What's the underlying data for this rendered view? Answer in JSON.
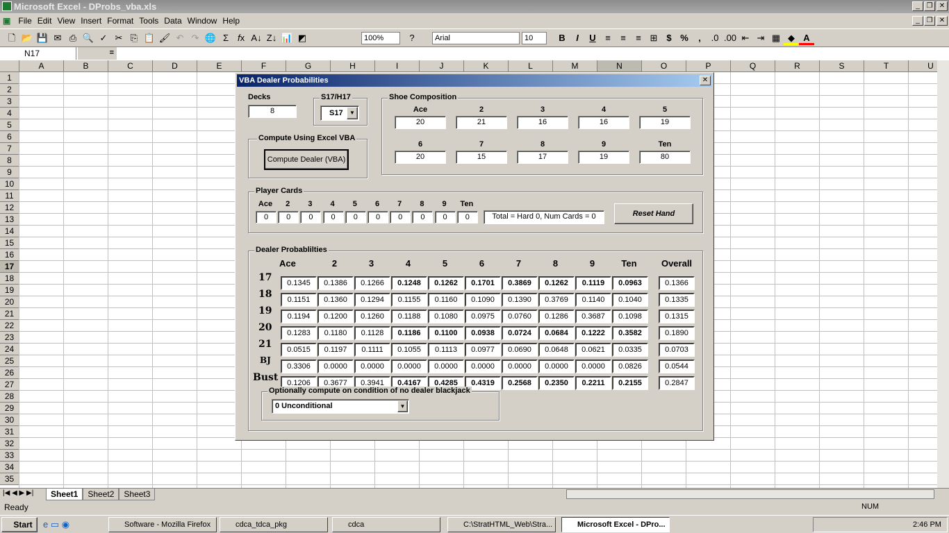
{
  "window": {
    "title": "Microsoft Excel - DProbs_vba.xls"
  },
  "menu": [
    "File",
    "Edit",
    "View",
    "Insert",
    "Format",
    "Tools",
    "Data",
    "Window",
    "Help"
  ],
  "toolbar": {
    "zoom": "100%",
    "font": "Arial",
    "font_size": "10",
    "bold": "B",
    "italic": "I",
    "underline": "U",
    "currency": "$",
    "percent": "%",
    "comma": ","
  },
  "formula_bar": {
    "name_box": "N17",
    "equals": "=",
    "value": ""
  },
  "columns": [
    "A",
    "B",
    "C",
    "D",
    "E",
    "F",
    "G",
    "H",
    "I",
    "J",
    "K",
    "L",
    "M",
    "N",
    "O",
    "P",
    "Q",
    "R",
    "S",
    "T",
    "U"
  ],
  "rows": [
    "1",
    "2",
    "3",
    "4",
    "5",
    "6",
    "7",
    "8",
    "9",
    "10",
    "11",
    "12",
    "13",
    "14",
    "15",
    "16",
    "17",
    "18",
    "19",
    "20",
    "21",
    "22",
    "23",
    "24",
    "25",
    "26",
    "27",
    "28",
    "29",
    "30",
    "31",
    "32",
    "33",
    "34",
    "35"
  ],
  "sheets": [
    "Sheet1",
    "Sheet2",
    "Sheet3"
  ],
  "status": {
    "text": "Ready",
    "num": "NUM"
  },
  "dialog": {
    "title": "VBA Dealer Probabilities",
    "decks": {
      "label": "Decks",
      "value": "8"
    },
    "soft17": {
      "label": "S17/H17",
      "value": "S17"
    },
    "compute": {
      "label": "Compute Using Excel VBA",
      "button": "Compute Dealer (VBA)"
    },
    "shoe": {
      "label": "Shoe Composition",
      "cards": [
        {
          "label": "Ace",
          "value": "20"
        },
        {
          "label": "2",
          "value": "21"
        },
        {
          "label": "3",
          "value": "16"
        },
        {
          "label": "4",
          "value": "16"
        },
        {
          "label": "5",
          "value": "19"
        },
        {
          "label": "6",
          "value": "20"
        },
        {
          "label": "7",
          "value": "15"
        },
        {
          "label": "8",
          "value": "17"
        },
        {
          "label": "9",
          "value": "19"
        },
        {
          "label": "Ten",
          "value": "80"
        }
      ]
    },
    "player": {
      "label": "Player Cards",
      "cards": [
        {
          "label": "Ace",
          "value": "0"
        },
        {
          "label": "2",
          "value": "0"
        },
        {
          "label": "3",
          "value": "0"
        },
        {
          "label": "4",
          "value": "0"
        },
        {
          "label": "5",
          "value": "0"
        },
        {
          "label": "6",
          "value": "0"
        },
        {
          "label": "7",
          "value": "0"
        },
        {
          "label": "8",
          "value": "0"
        },
        {
          "label": "9",
          "value": "0"
        },
        {
          "label": "Ten",
          "value": "0"
        }
      ],
      "total": "Total = Hard 0, Num Cards = 0",
      "reset": "Reset Hand"
    },
    "probs": {
      "label": "Dealer Probablilties",
      "columns": [
        "Ace",
        "2",
        "3",
        "4",
        "5",
        "6",
        "7",
        "8",
        "9",
        "Ten",
        "Overall"
      ],
      "rows": [
        {
          "label": "17",
          "values": [
            "0.1345",
            "0.1386",
            "0.1266",
            "0.1248",
            "0.1262",
            "0.1701",
            "0.3869",
            "0.1262",
            "0.1119",
            "0.0963",
            "0.1366"
          ]
        },
        {
          "label": "18",
          "values": [
            "0.1151",
            "0.1360",
            "0.1294",
            "0.1155",
            "0.1160",
            "0.1090",
            "0.1390",
            "0.3769",
            "0.1140",
            "0.1040",
            "0.1335"
          ]
        },
        {
          "label": "19",
          "values": [
            "0.1194",
            "0.1200",
            "0.1260",
            "0.1188",
            "0.1080",
            "0.0975",
            "0.0760",
            "0.1286",
            "0.3687",
            "0.1098",
            "0.1315"
          ]
        },
        {
          "label": "20",
          "values": [
            "0.1283",
            "0.1180",
            "0.1128",
            "0.1186",
            "0.1100",
            "0.0938",
            "0.0724",
            "0.0684",
            "0.1222",
            "0.3582",
            "0.1890"
          ]
        },
        {
          "label": "21",
          "values": [
            "0.0515",
            "0.1197",
            "0.1111",
            "0.1055",
            "0.1113",
            "0.0977",
            "0.0690",
            "0.0648",
            "0.0621",
            "0.0335",
            "0.0703"
          ]
        },
        {
          "label": "BJ",
          "values": [
            "0.3306",
            "0.0000",
            "0.0000",
            "0.0000",
            "0.0000",
            "0.0000",
            "0.0000",
            "0.0000",
            "0.0000",
            "0.0826",
            "0.0544"
          ]
        },
        {
          "label": "Bust",
          "values": [
            "0.1206",
            "0.3677",
            "0.3941",
            "0.4167",
            "0.4285",
            "0.4319",
            "0.2568",
            "0.2350",
            "0.2211",
            "0.2155",
            "0.2847"
          ]
        }
      ]
    },
    "condition": {
      "label": "Optionally compute on condition of no dealer blackjack",
      "value": "0 Unconditional"
    }
  },
  "taskbar": {
    "start": "Start",
    "tasks": [
      "Software - Mozilla Firefox",
      "cdca_tdca_pkg",
      "cdca",
      "C:\\StratHTML_Web\\Stra...",
      "Microsoft Excel - DPro..."
    ],
    "clock": "2:46 PM"
  }
}
